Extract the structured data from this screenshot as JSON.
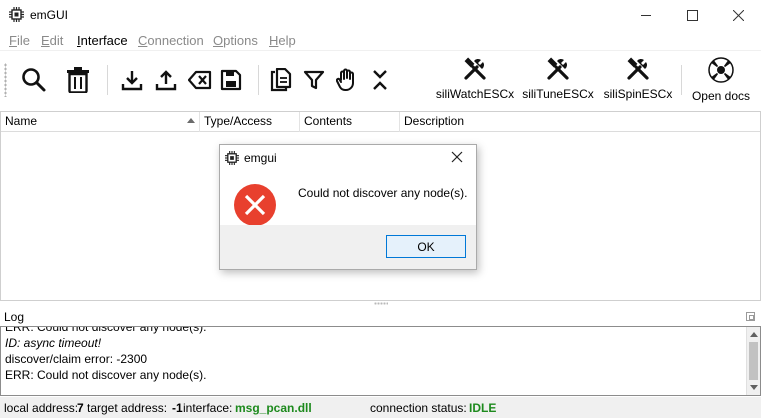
{
  "window": {
    "title": "emGUI",
    "icon": "chip-icon"
  },
  "menu": [
    {
      "label": "File",
      "accel": "F",
      "rest": "ile",
      "enabled": false
    },
    {
      "label": "Edit",
      "accel": "E",
      "rest": "dit",
      "enabled": false
    },
    {
      "label": "Interface",
      "accel": "I",
      "rest": "nterface",
      "enabled": true
    },
    {
      "label": "Connection",
      "accel": "C",
      "rest": "onnection",
      "enabled": false
    },
    {
      "label": "Options",
      "accel": "O",
      "rest": "ptions",
      "enabled": false
    },
    {
      "label": "Help",
      "accel": "H",
      "rest": "elp",
      "enabled": false
    }
  ],
  "toolbar": {
    "icons": [
      "search-icon",
      "trash-icon",
      "download-icon",
      "upload-icon",
      "clear-icon",
      "save-icon",
      "paste-icon",
      "filter-icon",
      "hand-icon",
      "collapse-icon"
    ],
    "tools": [
      {
        "label": "siliWatchESCx",
        "icon": "wrench-hammer-icon"
      },
      {
        "label": "siliTuneESCx",
        "icon": "wrench-hammer-icon"
      },
      {
        "label": "siliSpinESCx",
        "icon": "wrench-hammer-icon"
      }
    ],
    "docs": {
      "label": "Open docs",
      "icon": "lifebuoy-icon"
    }
  },
  "tree": {
    "columns": [
      "Name",
      "Type/Access",
      "Contents",
      "Description"
    ]
  },
  "log": {
    "title": "Log",
    "lines": [
      {
        "text": "ERR: Could not discover any node(s).",
        "italic": false
      },
      {
        "text": "ID: async timeout!",
        "italic": true
      },
      {
        "text": "discover/claim error: -2300",
        "italic": false
      },
      {
        "text": "ERR: Could not discover any node(s).",
        "italic": false
      }
    ]
  },
  "status": {
    "local_label": "local address:",
    "local_value": "7",
    "target_label": "target address:",
    "target_value": "-1",
    "interface_label": "interface:",
    "interface_value": "msg_pcan.dll",
    "conn_label": "connection status:",
    "conn_value": "IDLE",
    "ok_color": "#1d8a1d"
  },
  "dialog": {
    "title": "emgui",
    "message": "Could not discover any node(s).",
    "ok_label": "OK",
    "icon": "error-icon",
    "error_color": "#e8402e"
  }
}
